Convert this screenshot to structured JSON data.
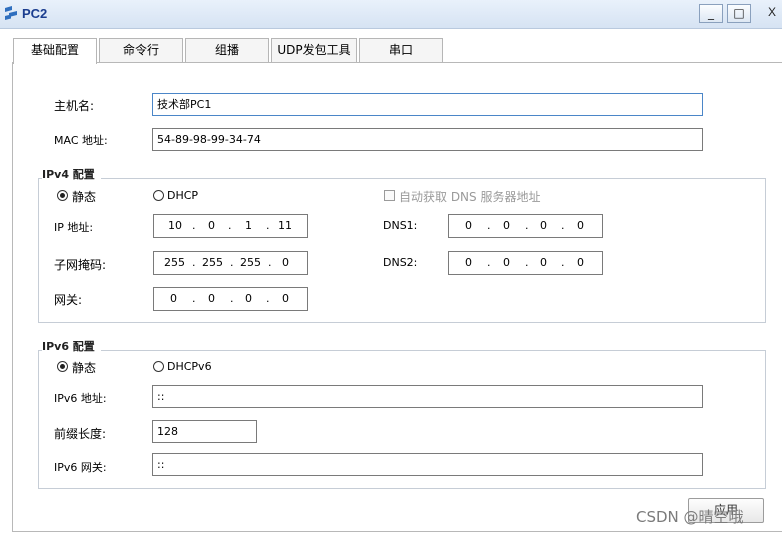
{
  "window": {
    "title": "PC2",
    "minimize": "_",
    "maximize": "□",
    "close": "X"
  },
  "tabs": [
    {
      "label": "基础配置"
    },
    {
      "label": "命令行"
    },
    {
      "label": "组播"
    },
    {
      "label": "UDP发包工具"
    },
    {
      "label": "串口"
    }
  ],
  "basic": {
    "hostname_label": "主机名:",
    "hostname_value": "技术部PC1",
    "mac_label": "MAC 地址:",
    "mac_value": "54-89-98-99-34-74"
  },
  "ipv4": {
    "group_title": "IPv4 配置",
    "static_label": "静态",
    "dhcp_label": "DHCP",
    "auto_dns_label": "自动获取 DNS 服务器地址",
    "ip_label": "IP 地址:",
    "ip": [
      "10",
      "0",
      "1",
      "11"
    ],
    "mask_label": "子网掩码:",
    "mask": [
      "255",
      "255",
      "255",
      "0"
    ],
    "gateway_label": "网关:",
    "gateway": [
      "0",
      "0",
      "0",
      "0"
    ],
    "dns1_label": "DNS1:",
    "dns1": [
      "0",
      "0",
      "0",
      "0"
    ],
    "dns2_label": "DNS2:",
    "dns2": [
      "0",
      "0",
      "0",
      "0"
    ],
    "dot": "."
  },
  "ipv6": {
    "group_title": "IPv6 配置",
    "static_label": "静态",
    "dhcp_label": "DHCPv6",
    "addr_label": "IPv6 地址:",
    "addr_value": "::",
    "prefix_label": "前缀长度:",
    "prefix_value": "128",
    "gateway_label": "IPv6 网关:",
    "gateway_value": "::"
  },
  "apply_label": "应用",
  "watermark": "CSDN @晴空哦",
  "colors": {
    "title_text": "#1b3d8f",
    "focus_border": "#4b86c8"
  }
}
